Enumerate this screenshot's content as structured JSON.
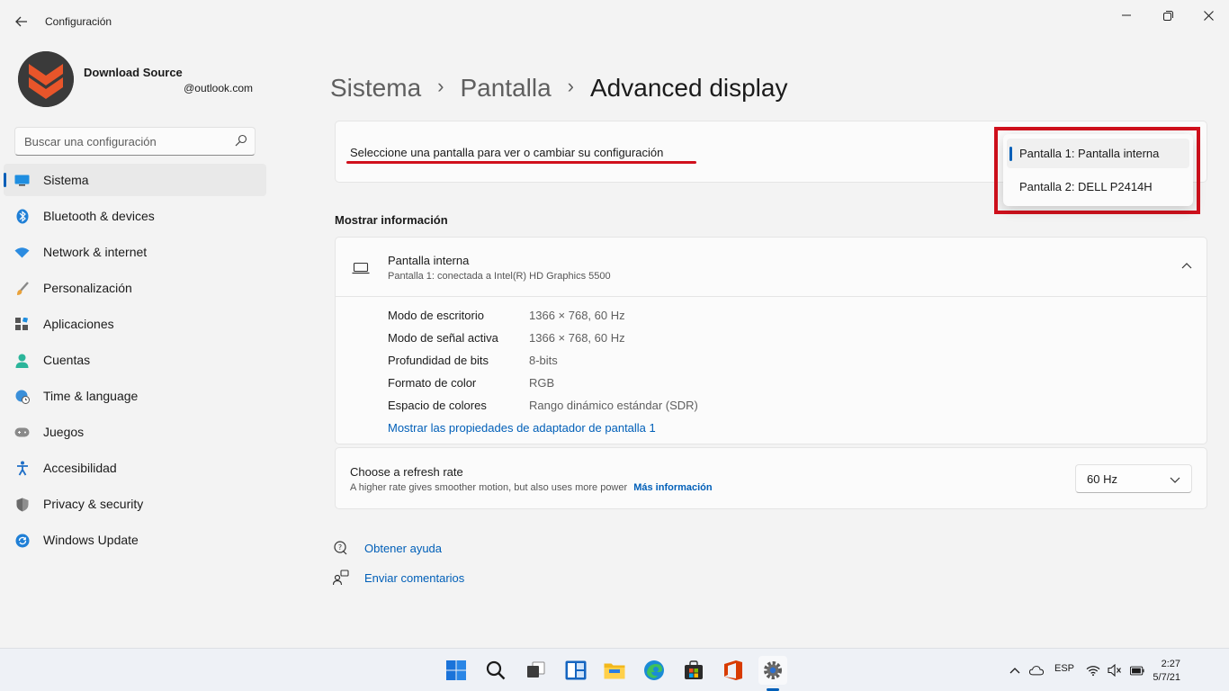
{
  "window": {
    "title": "Configuración",
    "back_icon": "arrow-left-icon",
    "controls": [
      "minimize-icon",
      "restore-icon",
      "close-icon"
    ]
  },
  "profile": {
    "name": "Download Source",
    "email": "@outlook.com",
    "avatar_icon": "download-source-logo"
  },
  "search": {
    "placeholder": "Buscar una configuración",
    "icon": "search-icon"
  },
  "sidebar": {
    "items": [
      {
        "label": "Sistema",
        "icon": "system-display-icon",
        "active": true
      },
      {
        "label": "Bluetooth & devices",
        "icon": "bluetooth-icon"
      },
      {
        "label": "Network & internet",
        "icon": "wifi-icon"
      },
      {
        "label": "Personalización",
        "icon": "brush-icon"
      },
      {
        "label": "Aplicaciones",
        "icon": "apps-icon"
      },
      {
        "label": "Cuentas",
        "icon": "person-icon"
      },
      {
        "label": "Time & language",
        "icon": "globe-clock-icon"
      },
      {
        "label": "Juegos",
        "icon": "gamepad-icon"
      },
      {
        "label": "Accesibilidad",
        "icon": "accessibility-icon"
      },
      {
        "label": "Privacy & security",
        "icon": "shield-icon"
      },
      {
        "label": "Windows Update",
        "icon": "update-icon"
      }
    ]
  },
  "breadcrumb": {
    "items": [
      "Sistema",
      "Pantalla",
      "Advanced display"
    ],
    "separator": "›"
  },
  "display_select": {
    "label": "Seleccione una pantalla para ver o cambiar su configuración",
    "options": [
      {
        "label": "Pantalla 1: Pantalla interna",
        "selected": true
      },
      {
        "label": "Pantalla 2: DELL P2414H"
      }
    ]
  },
  "display_info": {
    "section_title": "Mostrar información",
    "title": "Pantalla interna",
    "subtitle": "Pantalla 1: conectada a Intel(R) HD Graphics 5500",
    "icon": "laptop-icon",
    "rows": [
      {
        "label": "Modo de escritorio",
        "value": "1366 × 768, 60 Hz"
      },
      {
        "label": "Modo de señal activa",
        "value": "1366 × 768, 60 Hz"
      },
      {
        "label": "Profundidad de bits",
        "value": "8-bits"
      },
      {
        "label": "Formato de color",
        "value": "RGB"
      },
      {
        "label": "Espacio de colores",
        "value": "Rango dinámico estándar (SDR)"
      }
    ],
    "adapter_link": "Mostrar las propiedades de adaptador de pantalla 1"
  },
  "refresh_rate": {
    "title": "Choose a refresh rate",
    "subtitle": "A higher rate gives smoother motion, but also uses more power",
    "more_info": "Más información",
    "value": "60 Hz"
  },
  "help": {
    "get_help": "Obtener ayuda",
    "feedback": "Enviar comentarios"
  },
  "taskbar": {
    "icons": [
      "start-icon",
      "search-icon",
      "task-view-icon",
      "widgets-icon",
      "file-explorer-icon",
      "edge-icon",
      "store-icon",
      "office-icon",
      "settings-icon"
    ],
    "language": "ESP",
    "time": "2:27",
    "date": "5/7/21"
  },
  "colors": {
    "accent": "#005fb8",
    "highlight": "#d0101c"
  }
}
